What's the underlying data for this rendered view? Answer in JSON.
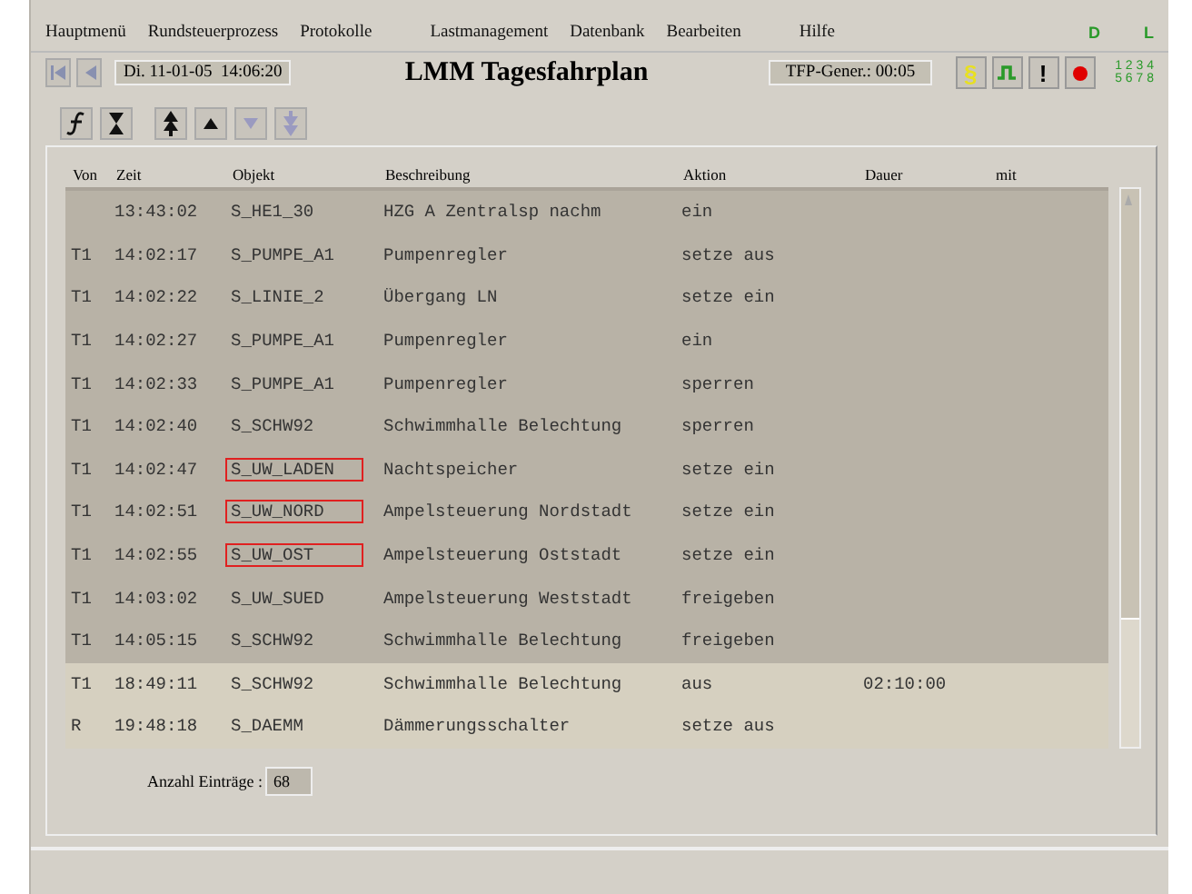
{
  "menu": [
    "Hauptmenü",
    "Rundsteuerprozess",
    "Protokolle",
    "Lastmanagement",
    "Datenbank",
    "Bearbeiten",
    "Hilfe"
  ],
  "menu_indicators": [
    "D",
    "L"
  ],
  "toolbar": {
    "datetime": "Di. 11-01-05  14:06:20",
    "title": "LMM Tagesfahrplan",
    "generator": "TFP-Gener.: 00:05",
    "status_buttons": [
      {
        "kind": "paragraph",
        "label": "§"
      },
      {
        "kind": "pulse"
      },
      {
        "kind": "alert",
        "label": "!"
      },
      {
        "kind": "record"
      }
    ],
    "channels_top": "1 2 3 4",
    "channels_bottom": "5 6 7 8"
  },
  "table": {
    "columns": [
      "Von",
      "Zeit",
      "Objekt",
      "Beschreibung",
      "Aktion",
      "Dauer",
      "mit"
    ],
    "rows": [
      {
        "von": "",
        "zeit": "13:43:02",
        "objekt": "S_HE1_30",
        "beschreibung": "HZG A Zentralsp nachm",
        "aktion": "ein",
        "past": true,
        "highlighted": false
      },
      {
        "von": "T1",
        "zeit": "14:02:17",
        "objekt": "S_PUMPE_A1",
        "beschreibung": "Pumpenregler",
        "aktion": "setze aus",
        "past": true,
        "highlighted": false
      },
      {
        "von": "T1",
        "zeit": "14:02:22",
        "objekt": "S_LINIE_2",
        "beschreibung": "Übergang LN",
        "aktion": "setze ein",
        "past": true,
        "highlighted": false
      },
      {
        "von": "T1",
        "zeit": "14:02:27",
        "objekt": "S_PUMPE_A1",
        "beschreibung": "Pumpenregler",
        "aktion": "ein",
        "past": true,
        "highlighted": false
      },
      {
        "von": "T1",
        "zeit": "14:02:33",
        "objekt": "S_PUMPE_A1",
        "beschreibung": "Pumpenregler",
        "aktion": "sperren",
        "past": true,
        "highlighted": false
      },
      {
        "von": "T1",
        "zeit": "14:02:40",
        "objekt": "S_SCHW92",
        "beschreibung": "Schwimmhalle Belechtung",
        "aktion": "sperren",
        "past": true,
        "highlighted": false
      },
      {
        "von": "T1",
        "zeit": "14:02:47",
        "objekt": "S_UW_LADEN",
        "beschreibung": "Nachtspeicher",
        "aktion": "setze ein",
        "past": true,
        "highlighted": true
      },
      {
        "von": "T1",
        "zeit": "14:02:51",
        "objekt": "S_UW_NORD",
        "beschreibung": "Ampelsteuerung Nordstadt",
        "aktion": "setze ein",
        "past": true,
        "highlighted": true
      },
      {
        "von": "T1",
        "zeit": "14:02:55",
        "objekt": "S_UW_OST",
        "beschreibung": "Ampelsteuerung Oststadt",
        "aktion": "setze ein",
        "past": true,
        "highlighted": true
      },
      {
        "von": "T1",
        "zeit": "14:03:02",
        "objekt": "S_UW_SUED",
        "beschreibung": "Ampelsteuerung Weststadt",
        "aktion": "freigeben",
        "past": true,
        "highlighted": false
      },
      {
        "von": "T1",
        "zeit": "14:05:15",
        "objekt": "S_SCHW92",
        "beschreibung": "Schwimmhalle Belechtung",
        "aktion": "freigeben",
        "past": true,
        "highlighted": false
      },
      {
        "von": "T1",
        "zeit": "18:49:11",
        "objekt": "S_SCHW92",
        "beschreibung": "Schwimmhalle Belechtung",
        "aktion": "aus",
        "dauer": "02:10:00",
        "past": false,
        "highlighted": false
      },
      {
        "von": "R",
        "zeit": "19:48:18",
        "objekt": "S_DAEMM",
        "beschreibung": "Dämmerungsschalter",
        "aktion": "setze aus",
        "past": false,
        "highlighted": false
      }
    ]
  },
  "footer": {
    "label": "Anzahl Einträge :",
    "count": "68"
  }
}
